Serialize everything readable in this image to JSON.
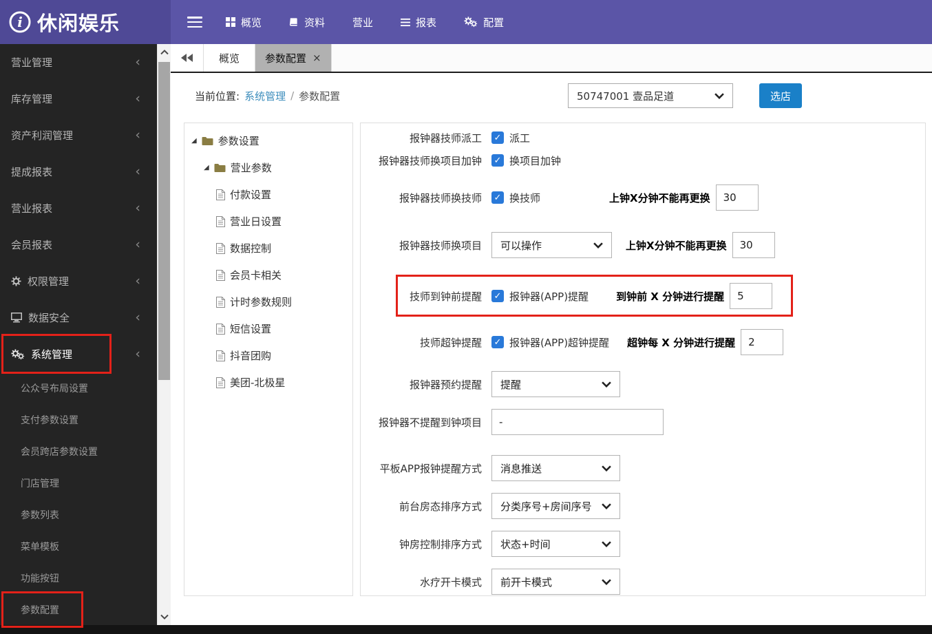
{
  "colors": {
    "navbar_purple": "#5b55a7",
    "logo_purple": "#4f4996",
    "sidebar_dark": "#242424",
    "button_blue": "#1a80c8",
    "checkbox_blue": "#2979d9",
    "link_blue": "#3c8dbc",
    "annotation_red": "#e32119",
    "active_tab_gray": "#b1b1b1"
  },
  "navbar": {
    "brand": "休闲娱乐",
    "menu": [
      {
        "label": "概览"
      },
      {
        "label": "资料"
      },
      {
        "label": "营业"
      },
      {
        "label": "报表"
      },
      {
        "label": "配置"
      }
    ]
  },
  "sidebar": {
    "items": [
      {
        "label": "营业管理"
      },
      {
        "label": "库存管理"
      },
      {
        "label": "资产利润管理"
      },
      {
        "label": "提成报表"
      },
      {
        "label": "营业报表"
      },
      {
        "label": "会员报表"
      },
      {
        "label": "权限管理"
      },
      {
        "label": "数据安全"
      },
      {
        "label": "系统管理"
      }
    ],
    "submenu": [
      {
        "label": "公众号布局设置"
      },
      {
        "label": "支付参数设置"
      },
      {
        "label": "会员跨店参数设置"
      },
      {
        "label": "门店管理"
      },
      {
        "label": "参数列表"
      },
      {
        "label": "菜单模板"
      },
      {
        "label": "功能按钮"
      },
      {
        "label": "参数配置"
      }
    ]
  },
  "tabs": {
    "items": [
      {
        "label": "概览"
      },
      {
        "label": "参数配置"
      }
    ]
  },
  "breadcrumb": {
    "prefix": "当前位置:",
    "link": "系统管理",
    "separator": "/",
    "current": "参数配置"
  },
  "store": {
    "selected": "50747001 壹品足道",
    "button": "选店"
  },
  "tree": {
    "nodes": [
      {
        "label": "参数设置"
      },
      {
        "label": "营业参数"
      }
    ],
    "leaves": [
      {
        "label": "付款设置"
      },
      {
        "label": "营业日设置"
      },
      {
        "label": "数据控制"
      },
      {
        "label": "会员卡相关"
      },
      {
        "label": "计时参数规则"
      },
      {
        "label": "短信设置"
      },
      {
        "label": "抖音团购"
      },
      {
        "label": "美团-北极星"
      }
    ]
  },
  "form": {
    "rows": [
      {
        "label": "报钟器技师派工",
        "checkbox_label": "派工",
        "checked": true
      },
      {
        "label": "报钟器技师换项目加钟",
        "checkbox_label": "换项目加钟",
        "checked": true
      },
      {
        "label": "报钟器技师换技师",
        "checkbox_label": "换技师",
        "checked": true,
        "extra_label": "上钟X分钟不能再更换",
        "value": "30"
      },
      {
        "label": "报钟器技师换项目",
        "select": "可以操作",
        "extra_label": "上钟X分钟不能再更换",
        "value": "30"
      },
      {
        "label": "技师到钟前提醒",
        "checkbox_label": "报钟器(APP)提醒",
        "checked": true,
        "extra_label": "到钟前 X 分钟进行提醒",
        "value": "5"
      },
      {
        "label": "技师超钟提醒",
        "checkbox_label": "报钟器(APP)超钟提醒",
        "checked": true,
        "extra_label": "超钟每 X 分钟进行提醒",
        "value": "2"
      },
      {
        "label": "报钟器预约提醒",
        "select": "提醒"
      },
      {
        "label": "报钟器不提醒到钟项目",
        "input": "-"
      },
      {
        "label": "平板APP报钟提醒方式",
        "select": "消息推送"
      },
      {
        "label": "前台房态排序方式",
        "select": "分类序号+房间序号"
      },
      {
        "label": "钟房控制排序方式",
        "select": "状态+时间"
      },
      {
        "label": "水疗开卡模式",
        "select": "前开卡模式"
      }
    ]
  }
}
